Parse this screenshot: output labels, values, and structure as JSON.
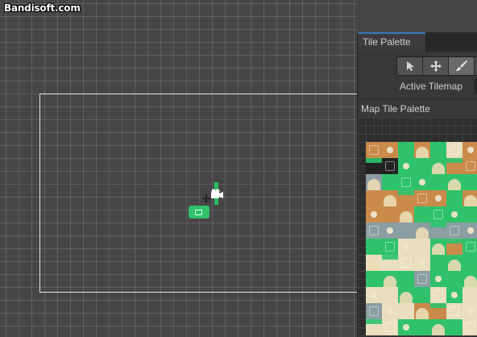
{
  "watermark": {
    "text": "Bandisoft.com"
  },
  "scene": {
    "gizmos": [
      "green-sprite",
      "camera-icon",
      "move-icon",
      "axis-handle"
    ]
  },
  "panel": {
    "tab_label": "Tile Palette",
    "tools": [
      {
        "name": "select",
        "icon": "arrow-cursor-icon",
        "active": false
      },
      {
        "name": "move",
        "icon": "move-arrows-icon",
        "active": false
      },
      {
        "name": "paint",
        "icon": "paintbrush-icon",
        "active": true
      }
    ],
    "active_tilemap_label": "Active Tilemap",
    "palette_name": "Map Tile Palette"
  },
  "palette_tiles": [
    [
      "#c98a4a",
      "#c98a4a",
      "#2fc26a",
      "#c98a4a",
      "#2fc26a",
      "#e9dfbf",
      "#c98a4a"
    ],
    [
      "#222222",
      "#222222",
      "#2fc26a",
      "#2fc26a",
      "#2fc26a",
      "#c98a4a",
      "#c98a4a"
    ],
    [
      "#8b9ea2",
      "#2fc26a",
      "#2fc26a",
      "#2fc26a",
      "#2fc26a",
      "#2fc26a",
      "#2fc26a"
    ],
    [
      "#c98a4a",
      "#c98a4a",
      "#c98a4a",
      "#c98a4a",
      "#c98a4a",
      "#2fc26a",
      "#c98a4a"
    ],
    [
      "#c98a4a",
      "#c98a4a",
      "#c98a4a",
      "#2fc26a",
      "#2fc26a",
      "#2fc26a",
      "#2fc26a"
    ],
    [
      "#8b9ea2",
      "#8b9ea2",
      "#8b9ea2",
      "#8b9ea2",
      "#8b9ea2",
      "#8b9ea2",
      "#8b9ea2"
    ],
    [
      "#2fc26a",
      "#2fc26a",
      "#e9dfbf",
      "#e9dfbf",
      "#2fc26a",
      "#c98a4a",
      "#2fc26a"
    ],
    [
      "#e9dfbf",
      "#e9dfbf",
      "#e9dfbf",
      "#e9dfbf",
      "#2fc26a",
      "#2fc26a",
      "#2fc26a"
    ],
    [
      "#2fc26a",
      "#2fc26a",
      "#2fc26a",
      "#8b9ea2",
      "#2fc26a",
      "#2fc26a",
      "#2fc26a"
    ],
    [
      "#e9dfbf",
      "#e9dfbf",
      "#2fc26a",
      "#2fc26a",
      "#e9dfbf",
      "#2fc26a",
      "#e9dfbf"
    ],
    [
      "#8b9ea2",
      "#e9dfbf",
      "#e9dfbf",
      "#c98a4a",
      "#c98a4a",
      "#e9dfbf",
      "#e9dfbf"
    ],
    [
      "#e9dfbf",
      "#e9dfbf",
      "#2fc26a",
      "#2fc26a",
      "#2fc26a",
      "#2fc26a",
      "#e9dfbf"
    ]
  ],
  "colors": {
    "accent_tab": "#3a79bb",
    "tile_green": "#2fc26a",
    "tile_brown": "#c98a4a",
    "tile_sand": "#e9dfbf",
    "tile_slate": "#8b9ea2"
  }
}
